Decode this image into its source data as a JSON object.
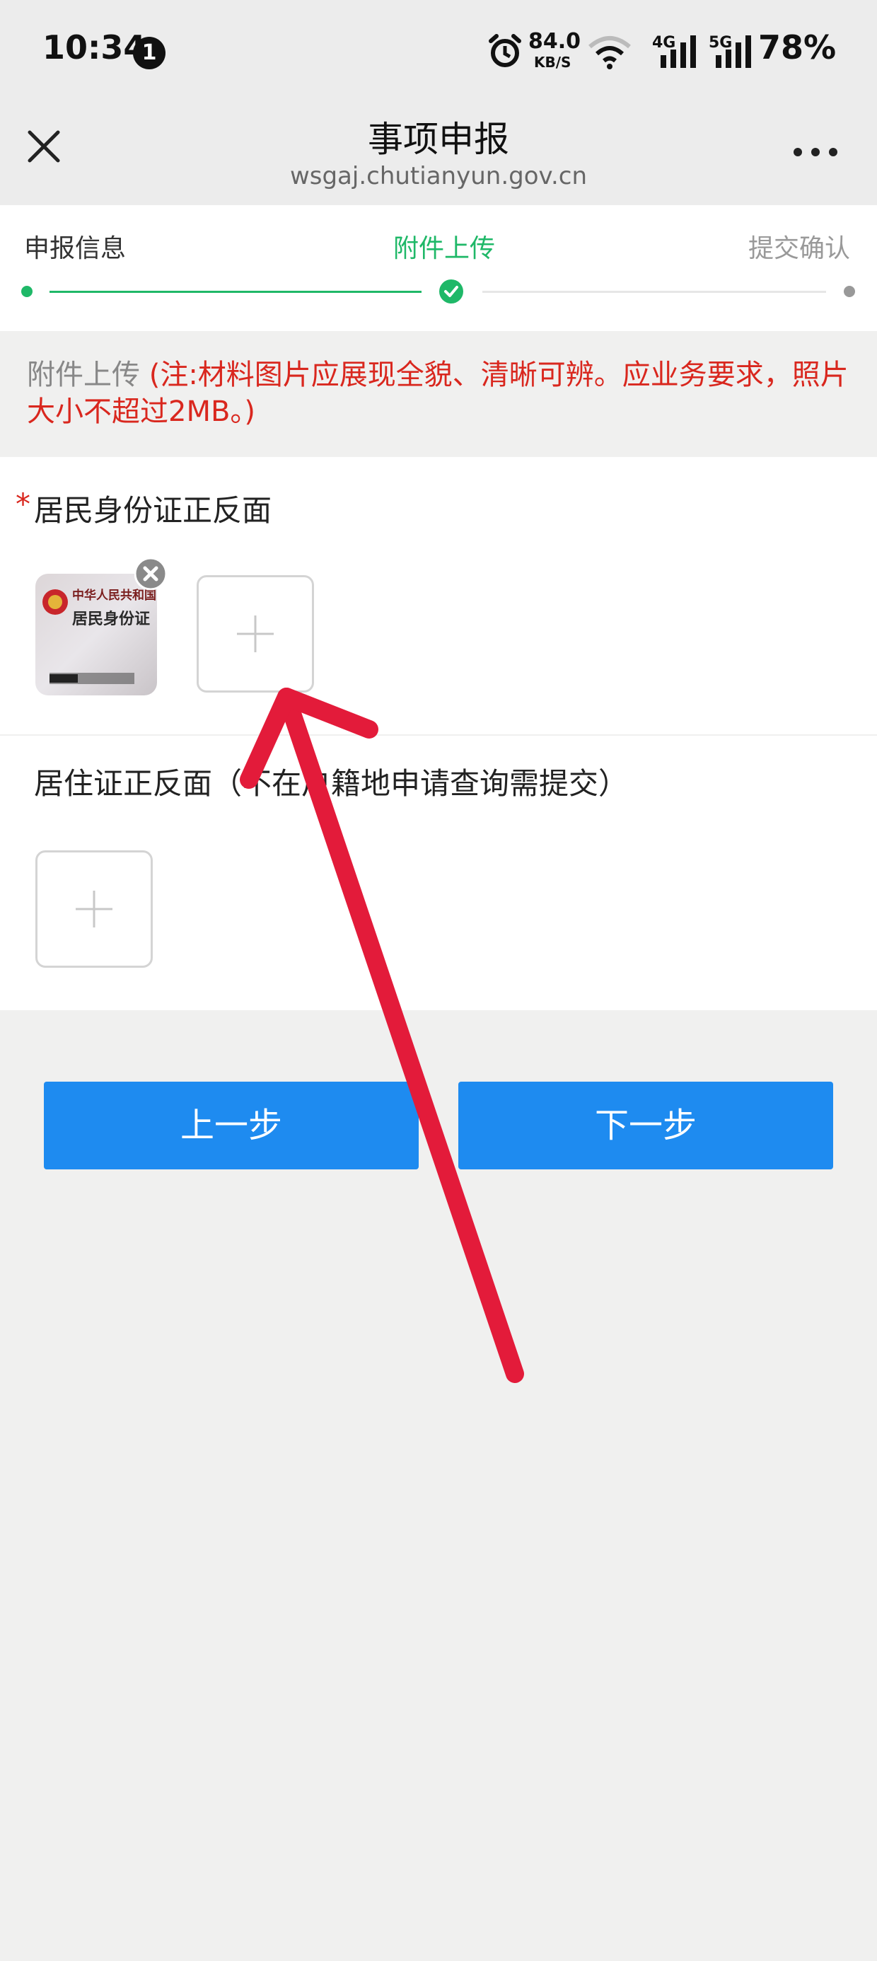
{
  "status_bar": {
    "time": "10:34",
    "notification_count": "1",
    "net_speed": "84.0",
    "net_speed_unit": "KB/S",
    "signal_a": "4G",
    "signal_b": "5G",
    "battery": "78%"
  },
  "header": {
    "title": "事项申报",
    "url": "wsgaj.chutianyun.gov.cn"
  },
  "steps": [
    {
      "label": "申报信息",
      "state": "done"
    },
    {
      "label": "附件上传",
      "state": "active"
    },
    {
      "label": "提交确认",
      "state": "pending"
    }
  ],
  "colors": {
    "accent_green": "#1fb868",
    "button_blue": "#1e8bf0",
    "notice_red": "#d9271e",
    "annotation_red": "#e31b3a"
  },
  "notice": {
    "lead": "附件上传",
    "text": "(注:材料图片应展现全貌、清晰可辨。应业务要求，照片大小不超过2MB。)"
  },
  "sections": {
    "id_card": {
      "label": "居民身份证正反面",
      "required_mark": "*",
      "thumbnail_title_1": "中华人民共和国",
      "thumbnail_title_2": "居民身份证"
    },
    "residence": {
      "label": "居住证正反面（不在户籍地申请查询需提交）"
    }
  },
  "buttons": {
    "prev": "上一步",
    "next": "下一步"
  }
}
